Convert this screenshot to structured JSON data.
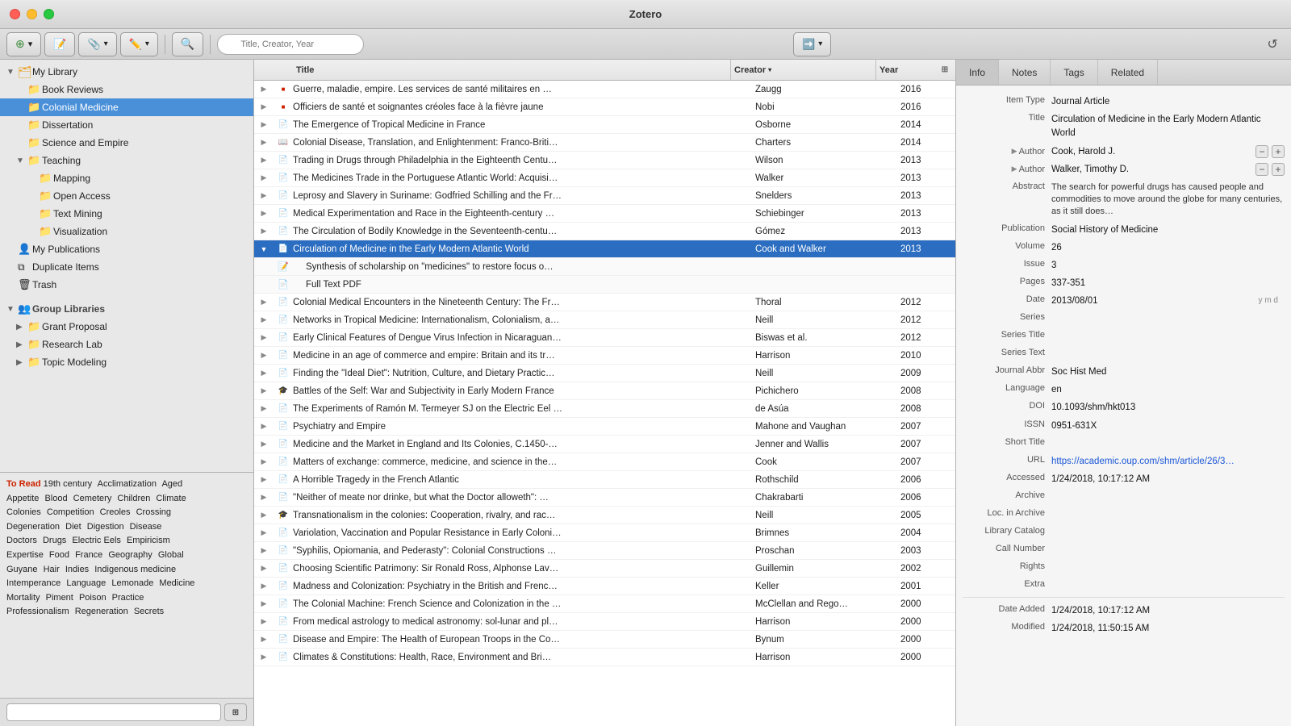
{
  "app": {
    "title": "Zotero"
  },
  "toolbar": {
    "new_item_label": "New Item",
    "new_note_label": "New Note",
    "attach_label": "Attach",
    "search_placeholder": "Title, Creator, Year",
    "locate_label": "Locate"
  },
  "sidebar": {
    "my_library": "My Library",
    "book_reviews": "Book Reviews",
    "colonial_medicine": "Colonial Medicine",
    "dissertation": "Dissertation",
    "science_and_empire": "Science and Empire",
    "teaching": "Teaching",
    "mapping": "Mapping",
    "open_access": "Open Access",
    "text_mining": "Text Mining",
    "visualization": "Visualization",
    "my_publications": "My Publications",
    "duplicate_items": "Duplicate Items",
    "trash": "Trash",
    "group_libraries": "Group Libraries",
    "grant_proposal": "Grant Proposal",
    "research_lab": "Research Lab",
    "topic_modeling": "Topic Modeling",
    "tag_header": "To Read",
    "tags": [
      "19th century",
      "Acclimatization",
      "Aged",
      "Appetite",
      "Blood",
      "Cemetery",
      "Children",
      "Climate",
      "Colonies",
      "Competition",
      "Creoles",
      "Crossing",
      "Degeneration",
      "Diet",
      "Digestion",
      "Disease",
      "Doctors",
      "Drugs",
      "Electric Eels",
      "Empiricism",
      "Expertise",
      "Food",
      "France",
      "Geography",
      "Global",
      "Guyane",
      "Hair",
      "Indies",
      "Indigenous medicine",
      "Intemperance",
      "Language",
      "Lemonade",
      "Medicine",
      "Mortality",
      "Piment",
      "Poison",
      "Practice",
      "Professionalism",
      "Regeneration",
      "Secrets"
    ]
  },
  "columns": {
    "title": "Title",
    "creator": "Creator",
    "year": "Year"
  },
  "items": [
    {
      "id": 1,
      "expand": false,
      "type": "article-red",
      "title": "Guerre, maladie, empire. Les services de santé militaires en …",
      "creator": "Zaugg",
      "year": "2016",
      "selected": false,
      "child": false,
      "indent": 0
    },
    {
      "id": 2,
      "expand": false,
      "type": "article-red",
      "title": "Officiers de santé et soignantes créoles face à la fièvre jaune",
      "creator": "Nobi",
      "year": "2016",
      "selected": false,
      "child": false,
      "indent": 0
    },
    {
      "id": 3,
      "expand": false,
      "type": "article",
      "title": "The Emergence of Tropical Medicine in France",
      "creator": "Osborne",
      "year": "2014",
      "selected": false,
      "child": false,
      "indent": 0
    },
    {
      "id": 4,
      "expand": false,
      "type": "book",
      "title": "Colonial Disease, Translation, and Enlightenment: Franco-Briti…",
      "creator": "Charters",
      "year": "2014",
      "selected": false,
      "child": false,
      "indent": 0
    },
    {
      "id": 5,
      "expand": false,
      "type": "article",
      "title": "Trading in Drugs through Philadelphia in the Eighteenth Centu…",
      "creator": "Wilson",
      "year": "2013",
      "selected": false,
      "child": false,
      "indent": 0
    },
    {
      "id": 6,
      "expand": false,
      "type": "article",
      "title": "The Medicines Trade in the Portuguese Atlantic World: Acquisi…",
      "creator": "Walker",
      "year": "2013",
      "selected": false,
      "child": false,
      "indent": 0
    },
    {
      "id": 7,
      "expand": false,
      "type": "article",
      "title": "Leprosy and Slavery in Suriname: Godfried Schilling and the Fr…",
      "creator": "Snelders",
      "year": "2013",
      "selected": false,
      "child": false,
      "indent": 0
    },
    {
      "id": 8,
      "expand": false,
      "type": "article",
      "title": "Medical Experimentation and Race in the Eighteenth-century …",
      "creator": "Schiebinger",
      "year": "2013",
      "selected": false,
      "child": false,
      "indent": 0
    },
    {
      "id": 9,
      "expand": false,
      "type": "article",
      "title": "The Circulation of Bodily Knowledge in the Seventeenth-centu…",
      "creator": "Gómez",
      "year": "2013",
      "selected": false,
      "child": false,
      "indent": 0
    },
    {
      "id": 10,
      "expand": true,
      "type": "article",
      "title": "Circulation of Medicine in the Early Modern Atlantic World",
      "creator": "Cook and Walker",
      "year": "2013",
      "selected": true,
      "child": false,
      "indent": 0
    },
    {
      "id": 11,
      "expand": false,
      "type": "note",
      "title": "Synthesis of scholarship on \"medicines\" to restore focus o…",
      "creator": "",
      "year": "",
      "selected": false,
      "child": true,
      "indent": 1
    },
    {
      "id": 12,
      "expand": false,
      "type": "pdf",
      "title": "Full Text PDF",
      "creator": "",
      "year": "",
      "selected": false,
      "child": true,
      "indent": 1
    },
    {
      "id": 13,
      "expand": false,
      "type": "article",
      "title": "Colonial Medical Encounters in the Nineteenth Century: The Fr…",
      "creator": "Thoral",
      "year": "2012",
      "selected": false,
      "child": false,
      "indent": 0
    },
    {
      "id": 14,
      "expand": false,
      "type": "article",
      "title": "Networks in Tropical Medicine: Internationalism, Colonialism, a…",
      "creator": "Neill",
      "year": "2012",
      "selected": false,
      "child": false,
      "indent": 0
    },
    {
      "id": 15,
      "expand": false,
      "type": "article",
      "title": "Early Clinical Features of Dengue Virus Infection in Nicaraguan…",
      "creator": "Biswas et al.",
      "year": "2012",
      "selected": false,
      "child": false,
      "indent": 0
    },
    {
      "id": 16,
      "expand": false,
      "type": "article",
      "title": "Medicine in an age of commerce and empire: Britain and its tr…",
      "creator": "Harrison",
      "year": "2010",
      "selected": false,
      "child": false,
      "indent": 0
    },
    {
      "id": 17,
      "expand": false,
      "type": "article",
      "title": "Finding the \"Ideal Diet\": Nutrition, Culture, and Dietary Practic…",
      "creator": "Neill",
      "year": "2009",
      "selected": false,
      "child": false,
      "indent": 0
    },
    {
      "id": 18,
      "expand": false,
      "type": "thesis",
      "title": "Battles of the Self: War and Subjectivity in Early Modern France",
      "creator": "Pichichero",
      "year": "2008",
      "selected": false,
      "child": false,
      "indent": 0
    },
    {
      "id": 19,
      "expand": false,
      "type": "article",
      "title": "The Experiments of Ramón M. Termeyer SJ on the Electric Eel …",
      "creator": "de Asúa",
      "year": "2008",
      "selected": false,
      "child": false,
      "indent": 0
    },
    {
      "id": 20,
      "expand": false,
      "type": "article",
      "title": "Psychiatry and Empire",
      "creator": "Mahone and Vaughan",
      "year": "2007",
      "selected": false,
      "child": false,
      "indent": 0
    },
    {
      "id": 21,
      "expand": false,
      "type": "article",
      "title": "Medicine and the Market in England and Its Colonies, C.1450-…",
      "creator": "Jenner and Wallis",
      "year": "2007",
      "selected": false,
      "child": false,
      "indent": 0
    },
    {
      "id": 22,
      "expand": false,
      "type": "article",
      "title": "Matters of exchange: commerce, medicine, and science in the…",
      "creator": "Cook",
      "year": "2007",
      "selected": false,
      "child": false,
      "indent": 0
    },
    {
      "id": 23,
      "expand": false,
      "type": "article",
      "title": "A Horrible Tragedy in the French Atlantic",
      "creator": "Rothschild",
      "year": "2006",
      "selected": false,
      "child": false,
      "indent": 0
    },
    {
      "id": 24,
      "expand": false,
      "type": "article",
      "title": "\"Neither of meate nor drinke, but what the Doctor alloweth\": …",
      "creator": "Chakrabarti",
      "year": "2006",
      "selected": false,
      "child": false,
      "indent": 0
    },
    {
      "id": 25,
      "expand": false,
      "type": "thesis",
      "title": "Transnationalism in the colonies: Cooperation, rivalry, and rac…",
      "creator": "Neill",
      "year": "2005",
      "selected": false,
      "child": false,
      "indent": 0
    },
    {
      "id": 26,
      "expand": false,
      "type": "article",
      "title": "Variolation, Vaccination and Popular Resistance in Early Coloni…",
      "creator": "Brimnes",
      "year": "2004",
      "selected": false,
      "child": false,
      "indent": 0
    },
    {
      "id": 27,
      "expand": false,
      "type": "article",
      "title": "\"Syphilis, Opiomania, and Pederasty\": Colonial Constructions …",
      "creator": "Proschan",
      "year": "2003",
      "selected": false,
      "child": false,
      "indent": 0
    },
    {
      "id": 28,
      "expand": false,
      "type": "article",
      "title": "Choosing Scientific Patrimony: Sir Ronald Ross, Alphonse Lav…",
      "creator": "Guillemin",
      "year": "2002",
      "selected": false,
      "child": false,
      "indent": 0
    },
    {
      "id": 29,
      "expand": false,
      "type": "article",
      "title": "Madness and Colonization: Psychiatry in the British and Frenc…",
      "creator": "Keller",
      "year": "2001",
      "selected": false,
      "child": false,
      "indent": 0
    },
    {
      "id": 30,
      "expand": false,
      "type": "article",
      "title": "The Colonial Machine: French Science and Colonization in the …",
      "creator": "McClellan and Rego…",
      "year": "2000",
      "selected": false,
      "child": false,
      "indent": 0
    },
    {
      "id": 31,
      "expand": false,
      "type": "article",
      "title": "From medical astrology to medical astronomy: sol-lunar and pl…",
      "creator": "Harrison",
      "year": "2000",
      "selected": false,
      "child": false,
      "indent": 0
    },
    {
      "id": 32,
      "expand": false,
      "type": "article",
      "title": "Disease and Empire: The Health of European Troops in the Co…",
      "creator": "Bynum",
      "year": "2000",
      "selected": false,
      "child": false,
      "indent": 0
    },
    {
      "id": 33,
      "expand": false,
      "type": "article",
      "title": "Climates & Constitutions: Health, Race, Environment and Bri…",
      "creator": "Harrison",
      "year": "2000",
      "selected": false,
      "child": false,
      "indent": 0
    }
  ],
  "detail": {
    "tabs": [
      "Info",
      "Notes",
      "Tags",
      "Related"
    ],
    "active_tab": "Info",
    "fields": {
      "item_type_label": "Item Type",
      "item_type_value": "Journal Article",
      "title_label": "Title",
      "title_value": "Circulation of Medicine in the Early Modern Atlantic World",
      "author1_label": "Author",
      "author1_name": "Cook, Harold J.",
      "author2_label": "Author",
      "author2_name": "Walker, Timothy D.",
      "abstract_label": "Abstract",
      "abstract_value": "The search for powerful drugs has caused people and commodities to move around the globe for many centuries, as it still does…",
      "publication_label": "Publication",
      "publication_value": "Social History of Medicine",
      "volume_label": "Volume",
      "volume_value": "26",
      "issue_label": "Issue",
      "issue_value": "3",
      "pages_label": "Pages",
      "pages_value": "337-351",
      "date_label": "Date",
      "date_value": "2013/08/01",
      "series_label": "Series",
      "series_value": "",
      "series_title_label": "Series Title",
      "series_title_value": "",
      "series_text_label": "Series Text",
      "series_text_value": "",
      "journal_abbr_label": "Journal Abbr",
      "journal_abbr_value": "Soc Hist Med",
      "language_label": "Language",
      "language_value": "en",
      "doi_label": "DOI",
      "doi_value": "10.1093/shm/hkt013",
      "issn_label": "ISSN",
      "issn_value": "0951-631X",
      "short_title_label": "Short Title",
      "short_title_value": "",
      "url_label": "URL",
      "url_value": "https://academic.oup.com/shm/article/26/3…",
      "accessed_label": "Accessed",
      "accessed_value": "1/24/2018, 10:17:12 AM",
      "archive_label": "Archive",
      "archive_value": "",
      "loc_in_archive_label": "Loc. in Archive",
      "loc_in_archive_value": "",
      "library_catalog_label": "Library Catalog",
      "library_catalog_value": "",
      "call_number_label": "Call Number",
      "call_number_value": "",
      "rights_label": "Rights",
      "rights_value": "",
      "extra_label": "Extra",
      "extra_value": "",
      "date_added_label": "Date Added",
      "date_added_value": "1/24/2018, 10:17:12 AM",
      "modified_label": "Modified",
      "modified_value": "1/24/2018, 11:50:15 AM",
      "ymd_label": "y m d"
    }
  }
}
